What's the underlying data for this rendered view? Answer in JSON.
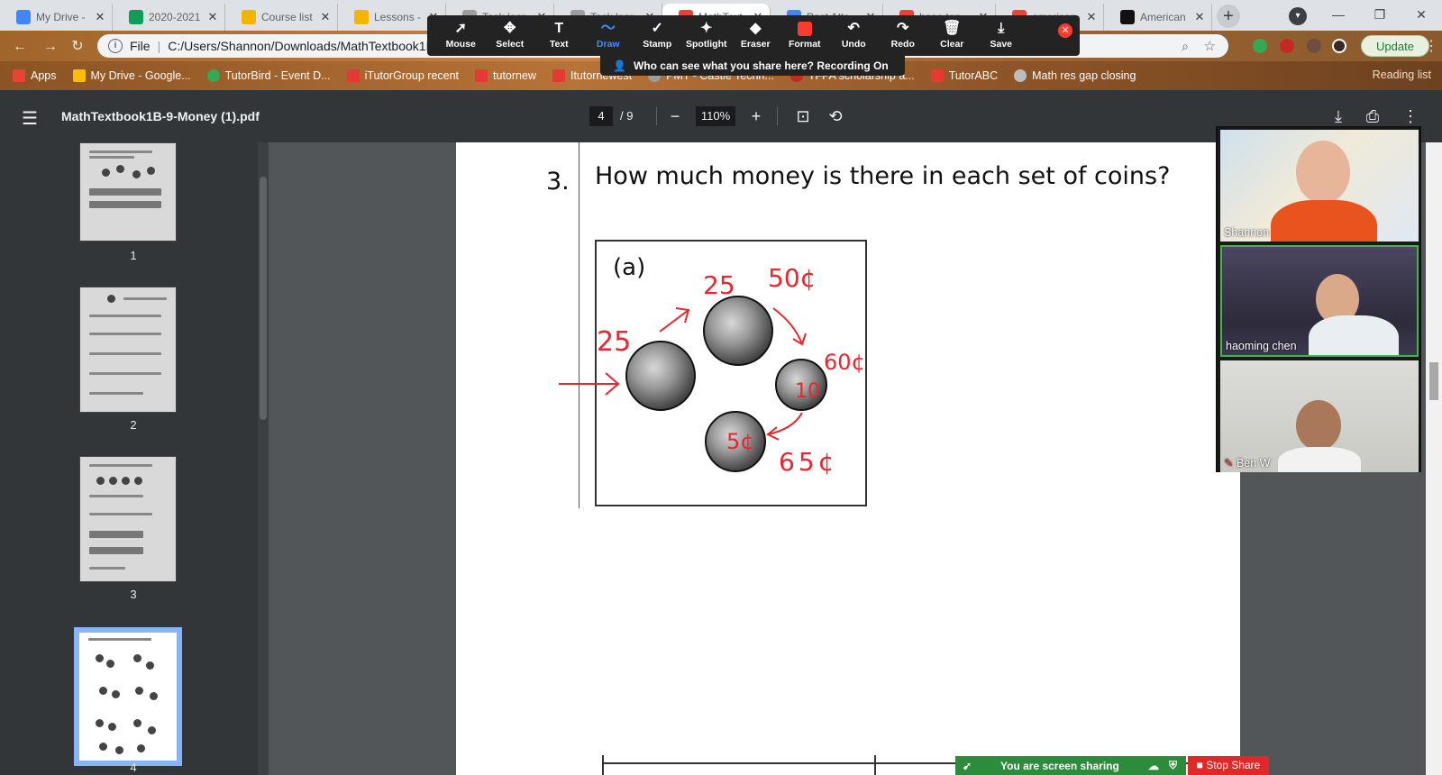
{
  "tabs": [
    {
      "title": "My Drive -",
      "favicon_color": "#4285f4"
    },
    {
      "title": "2020-2021",
      "favicon_color": "#0f9d58"
    },
    {
      "title": "Course list",
      "favicon_color": "#f4b400"
    },
    {
      "title": "Lessons - (",
      "favicon_color": "#f4b400"
    },
    {
      "title": "Task lear",
      "favicon_color": "#9e9e9e"
    },
    {
      "title": "Task lear",
      "favicon_color": "#9e9e9e"
    },
    {
      "title": "MathText",
      "favicon_color": "#ea4335"
    },
    {
      "title": "Post Atte",
      "favicon_color": "#4285f4"
    },
    {
      "title": "base ten",
      "favicon_color": "#ea4335"
    },
    {
      "title": "american",
      "favicon_color": "#ea4335"
    },
    {
      "title": "American",
      "favicon_color": "#111111"
    }
  ],
  "address_bar": {
    "scheme_label": "File",
    "url": "C:/Users/Shannon/Downloads/MathTextbook1B-9-Money (1).pdf",
    "update_label": "Update"
  },
  "bookmarks": [
    {
      "label": "Apps",
      "color": "#ea4335"
    },
    {
      "label": "My Drive - Google...",
      "color": "#fbbc05"
    },
    {
      "label": "TutorBird - Event D...",
      "color": "#34a853"
    },
    {
      "label": "iTutorGroup recent",
      "color": "#e53935"
    },
    {
      "label": "tutornew",
      "color": "#e53935"
    },
    {
      "label": "Itutornewest",
      "color": "#e53935"
    },
    {
      "label": "PMT - Castle Techn...",
      "color": "#9e9e9e"
    },
    {
      "label": "TFPA scholarship a...",
      "color": "#c62828"
    },
    {
      "label": "TutorABC",
      "color": "#e53935"
    },
    {
      "label": "Math res gap closing",
      "color": "#bdbdbd"
    }
  ],
  "reading_list_label": "Reading list",
  "zoom_toolbar": {
    "tools": [
      {
        "label": "Mouse",
        "glyph": "➚"
      },
      {
        "label": "Select",
        "glyph": "✥"
      },
      {
        "label": "Text",
        "glyph": "T"
      },
      {
        "label": "Draw",
        "glyph": "〜"
      },
      {
        "label": "Stamp",
        "glyph": "✓"
      },
      {
        "label": "Spotlight",
        "glyph": "✦"
      },
      {
        "label": "Eraser",
        "glyph": "◆"
      },
      {
        "label": "Format",
        "glyph": ""
      },
      {
        "label": "Undo",
        "glyph": "↶"
      },
      {
        "label": "Redo",
        "glyph": "↷"
      },
      {
        "label": "Clear",
        "glyph": "🗑"
      },
      {
        "label": "Save",
        "glyph": "⤓"
      }
    ],
    "active_tool": "Draw",
    "recording_notice": "Who can see what you share here? Recording On"
  },
  "pdf": {
    "filename": "MathTextbook1B-9-Money (1).pdf",
    "current_page": "4",
    "total_pages": "/ 9",
    "zoom": "110%",
    "thumbnails": [
      {
        "number": "1"
      },
      {
        "number": "2"
      },
      {
        "number": "3"
      },
      {
        "number": "4"
      }
    ],
    "question_number": "3.",
    "question_text": "How much money is there in each set of coins?",
    "part_label": "(a)",
    "annotations": {
      "a1": "25",
      "a2": "25",
      "a3": "50¢",
      "a4": "60¢",
      "a5": "10",
      "a6": "5¢",
      "a7": "65¢"
    }
  },
  "participants": [
    {
      "name": "Shannon"
    },
    {
      "name": "haoming   chen"
    },
    {
      "name": "Ben W"
    }
  ],
  "share_status": "You are screen sharing",
  "stop_share_label": "Stop Share"
}
